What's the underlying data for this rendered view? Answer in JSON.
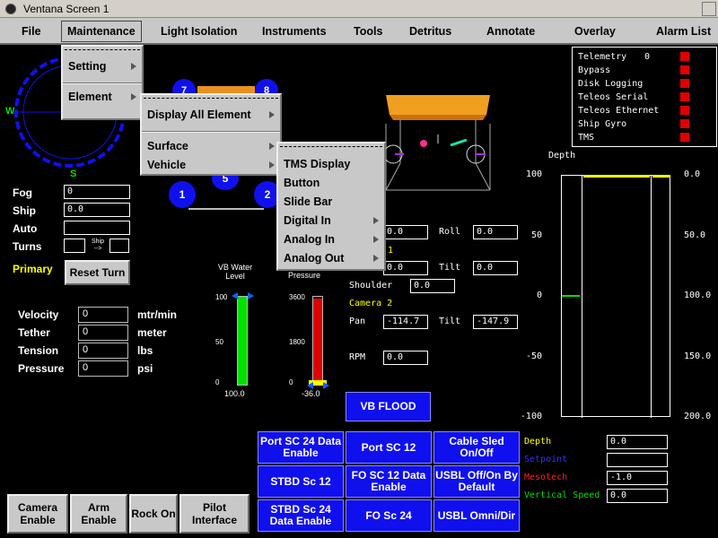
{
  "window": {
    "title": "Ventana Screen 1"
  },
  "menubar": {
    "file": "File",
    "maintenance": "Maintenance",
    "light_isolation": "Light Isolation",
    "instruments": "Instruments",
    "tools": "Tools",
    "detritus": "Detritus",
    "annotate": "Annotate",
    "overlay": "Overlay",
    "alarm_list": "Alarm List"
  },
  "menu_maintenance": {
    "setting": "Setting",
    "element": "Element"
  },
  "menu_element": {
    "display_all": "Display All Element",
    "surface": "Surface",
    "vehicle": "Vehicle"
  },
  "menu_surface": {
    "items": [
      "TMS Display",
      "Button",
      "Slide Bar",
      "Digital In",
      "Analog In",
      "Analog Out"
    ]
  },
  "compass": {
    "west": "W",
    "south": "S"
  },
  "thrusters": {
    "labels": [
      "7",
      "8",
      "1",
      "5",
      "2"
    ]
  },
  "left_fields": {
    "fog": {
      "label": "Fog",
      "value": "0"
    },
    "ship": {
      "label": "Ship",
      "value": "0.0"
    },
    "auto": {
      "label": "Auto",
      "value": ""
    },
    "turns": {
      "label": "Turns",
      "value": "",
      "ship_arrow": "Ship"
    },
    "primary": "Primary",
    "reset_turn": "Reset Turn"
  },
  "tether_fields": [
    {
      "label": "Velocity",
      "value": "0",
      "unit": "mtr/min"
    },
    {
      "label": "Tether",
      "value": "0",
      "unit": "meter"
    },
    {
      "label": "Tension",
      "value": "0",
      "unit": "lbs"
    },
    {
      "label": "Pressure",
      "value": "0",
      "unit": "psi"
    }
  ],
  "vb_gauge": {
    "title": "VB Water Level",
    "ticks": [
      "100",
      "50",
      "0"
    ],
    "value": "100.0",
    "level": 1.0,
    "color": "#00e000"
  },
  "pressure_gauge": {
    "title": "Pressure",
    "ticks": [
      "3600",
      "1800",
      "0"
    ],
    "value": "-36.0",
    "level": 0.98,
    "color": "#e00000"
  },
  "camera": {
    "val1": "0.0",
    "roll_label": "Roll",
    "roll_value": "0.0",
    "yellow_num": "1",
    "val2": "0.0",
    "tilt_label": "Tilt",
    "tilt_value": "0.0",
    "shoulder_label": "Shoulder",
    "shoulder_value": "0.0",
    "camera2_label": "Camera 2",
    "pan_label": "Pan",
    "pan_value": "-114.7",
    "tilt2_label": "Tilt",
    "tilt2_value": "-147.9",
    "rpm_label": "RPM",
    "rpm_value": "0.0"
  },
  "vb_flood": "VB FLOOD",
  "telemetry": {
    "items": [
      {
        "label": "Telemetry",
        "value": "0"
      },
      {
        "label": "Bypass",
        "value": ""
      },
      {
        "label": "Disk Logging",
        "value": ""
      },
      {
        "label": "Teleos Serial",
        "value": ""
      },
      {
        "label": "Teleos Ethernet",
        "value": ""
      },
      {
        "label": "Ship Gyro",
        "value": ""
      },
      {
        "label": "TMS",
        "value": ""
      }
    ],
    "led_color": "#e00000"
  },
  "depth_chart": {
    "title": "Depth",
    "left_ticks": [
      "100",
      "50",
      "0",
      "-50",
      "-100"
    ],
    "right_ticks": [
      "0.0",
      "50.0",
      "100.0",
      "150.0",
      "200.0"
    ],
    "depth_value": 0.0,
    "green_marker": 0
  },
  "buttons_grid": [
    [
      "Port SC 24 Data Enable",
      "Port SC 12",
      "Cable Sled On/Off"
    ],
    [
      "STBD Sc 12",
      "FO SC 12 Data Enable",
      "USBL Off/On By Default"
    ],
    [
      "STBD Sc 24 Data Enable",
      "FO Sc 24",
      "USBL Omni/Dir"
    ]
  ],
  "readouts": [
    {
      "label": "Depth",
      "value": "0.0",
      "color": "#ffff00"
    },
    {
      "label": "Setpoint",
      "value": "",
      "color": "#3030ff"
    },
    {
      "label": "Mesotech",
      "value": "-1.0",
      "color": "#ff2020"
    },
    {
      "label": "Vertical Speed",
      "value": "0.0",
      "color": "#00e000"
    }
  ],
  "bottom_buttons": [
    "Camera Enable",
    "Arm Enable",
    "Rock On",
    "Pilot Interface"
  ]
}
